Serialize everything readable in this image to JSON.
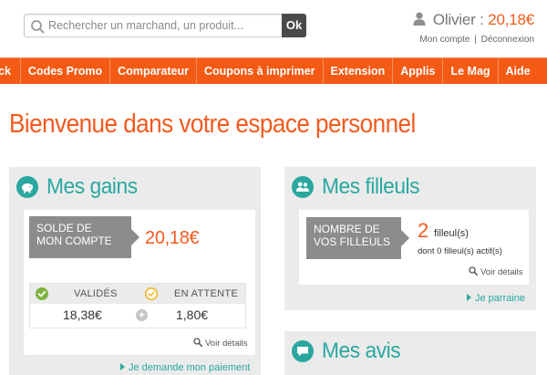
{
  "search": {
    "placeholder": "Rechercher un marchand, un produit...",
    "button_label": "Ok"
  },
  "user": {
    "name": "Olivier",
    "separator": ":",
    "balance": "20,18€",
    "account_link": "Mon compte",
    "link_separator": "|",
    "logout_link": "Déconnexion"
  },
  "nav": {
    "items": [
      {
        "label": "ck"
      },
      {
        "label": "Codes Promo"
      },
      {
        "label": "Comparateur"
      },
      {
        "label": "Coupons à imprimer"
      },
      {
        "label": "Extension"
      },
      {
        "label": "Applis"
      },
      {
        "label": "Le Mag"
      },
      {
        "label": "Aide"
      }
    ]
  },
  "page": {
    "title": "Bienvenue dans votre espace personnel"
  },
  "gains": {
    "title": "Mes gains",
    "balance_label_line1": "SOLDE DE",
    "balance_label_line2": "MON COMPTE",
    "balance_value": "20,18€",
    "validated_label": "VALIDÉS",
    "pending_label": "EN ATTENTE",
    "validated_value": "18,38€",
    "pending_value": "1,80€",
    "plus_symbol": "+",
    "details_link": "Voir détails",
    "payment_link": "Je demande mon paiement"
  },
  "filleuls": {
    "title": "Mes filleuls",
    "label_line1": "NOMBRE DE",
    "label_line2": "VOS FILLEULS",
    "count": "2",
    "unit": "filleul(s)",
    "active_text": "dont 0 filleul(s) actif(s)",
    "details_link": "Voir détails",
    "sponsor_link": "Je parraine"
  },
  "avis": {
    "title": "Mes avis"
  },
  "colors": {
    "accent_orange": "#f25a1f",
    "nav_orange": "#f45a14",
    "teal": "#2aa8a0",
    "label_grey": "#8c8c8c",
    "check_green": "#7cb342",
    "pending_yellow": "#f2b824"
  }
}
